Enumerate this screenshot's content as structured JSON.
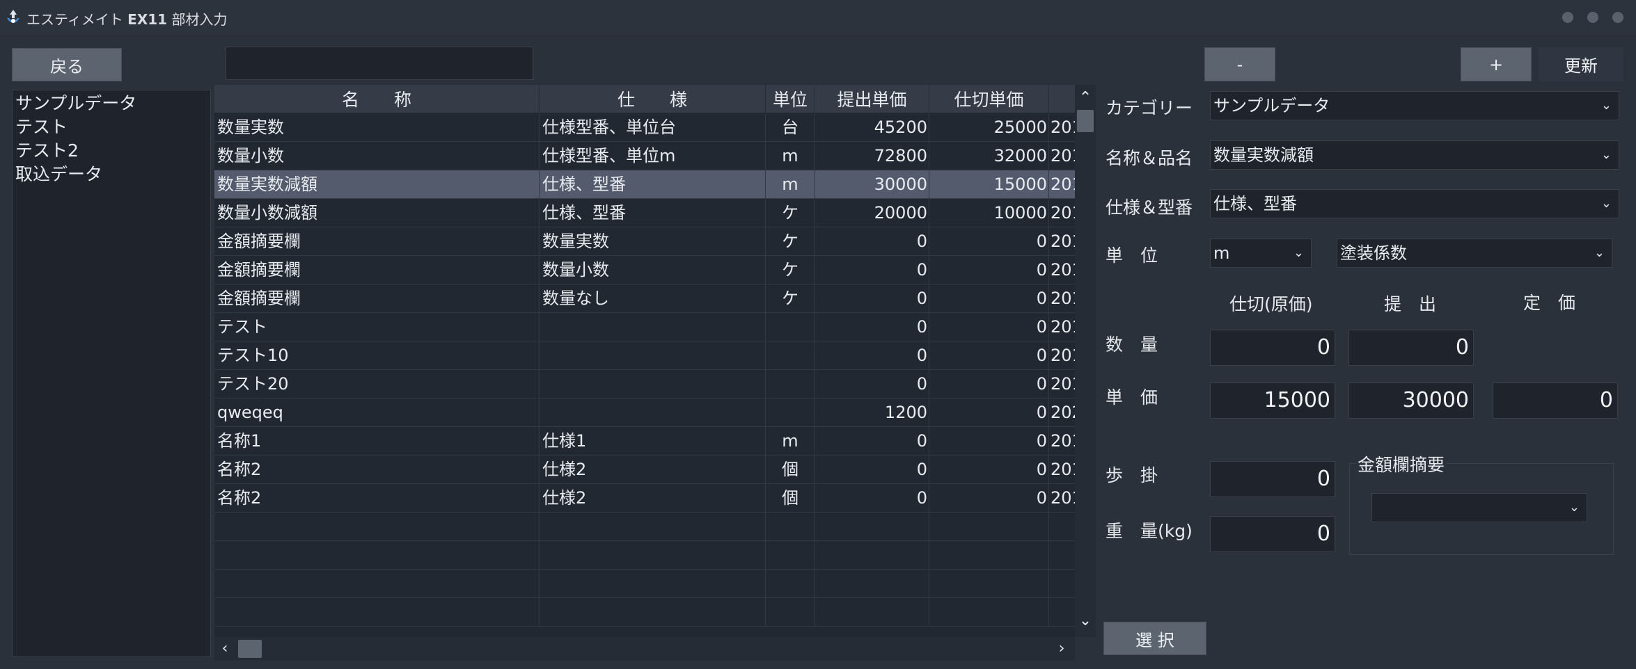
{
  "window": {
    "title_prefix": "エスティメイト",
    "title_bold": "EX11",
    "title_suffix": "部材入力"
  },
  "toolbar": {
    "back_label": "戻る",
    "search_value": "",
    "minus_label": "-",
    "plus_label": "+",
    "update_label": "更新"
  },
  "categories": [
    "サンプルデータ",
    "テスト",
    "テスト2",
    "取込データ"
  ],
  "grid": {
    "headers": [
      "名　　称",
      "仕　　様",
      "単位",
      "提出単価",
      "仕切単価"
    ],
    "rows": [
      {
        "name": "数量実数",
        "spec": "仕様型番、単位台",
        "unit": "台",
        "submit": "45200",
        "cost": "25000",
        "date": "201"
      },
      {
        "name": "数量小数",
        "spec": "仕様型番、単位m",
        "unit": "m",
        "submit": "72800",
        "cost": "32000",
        "date": "201"
      },
      {
        "name": "数量実数減額",
        "spec": "仕様、型番",
        "unit": "m",
        "submit": "30000",
        "cost": "15000",
        "date": "201"
      },
      {
        "name": "数量小数減額",
        "spec": "仕様、型番",
        "unit": "ケ",
        "submit": "20000",
        "cost": "10000",
        "date": "201"
      },
      {
        "name": "金額摘要欄",
        "spec": "数量実数",
        "unit": "ケ",
        "submit": "0",
        "cost": "0",
        "date": "201"
      },
      {
        "name": "金額摘要欄",
        "spec": "数量小数",
        "unit": "ケ",
        "submit": "0",
        "cost": "0",
        "date": "201"
      },
      {
        "name": "金額摘要欄",
        "spec": "数量なし",
        "unit": "ケ",
        "submit": "0",
        "cost": "0",
        "date": "201"
      },
      {
        "name": "テスト",
        "spec": "",
        "unit": "",
        "submit": "0",
        "cost": "0",
        "date": "201"
      },
      {
        "name": "テスト10",
        "spec": "",
        "unit": "",
        "submit": "0",
        "cost": "0",
        "date": "201"
      },
      {
        "name": "テスト20",
        "spec": "",
        "unit": "",
        "submit": "0",
        "cost": "0",
        "date": "201"
      },
      {
        "name": "qweqeq",
        "spec": "",
        "unit": "",
        "submit": "1200",
        "cost": "0",
        "date": "202"
      },
      {
        "name": "名称1",
        "spec": "仕様1",
        "unit": "m",
        "submit": "0",
        "cost": "0",
        "date": "201"
      },
      {
        "name": "名称2",
        "spec": "仕様2",
        "unit": "個",
        "submit": "0",
        "cost": "0",
        "date": "201"
      },
      {
        "name": "名称2",
        "spec": "仕様2",
        "unit": "個",
        "submit": "0",
        "cost": "0",
        "date": "201"
      },
      {
        "name": "",
        "spec": "",
        "unit": "",
        "submit": "",
        "cost": "",
        "date": ""
      },
      {
        "name": "",
        "spec": "",
        "unit": "",
        "submit": "",
        "cost": "",
        "date": ""
      },
      {
        "name": "",
        "spec": "",
        "unit": "",
        "submit": "",
        "cost": "",
        "date": ""
      },
      {
        "name": "",
        "spec": "",
        "unit": "",
        "submit": "",
        "cost": "",
        "date": ""
      }
    ],
    "selected_row": 2
  },
  "form": {
    "category_label": "カテゴリー",
    "category_value": "サンプルデータ",
    "name_label": "名称＆品名",
    "name_value": "数量実数減額",
    "spec_label": "仕様＆型番",
    "spec_value": "仕様、型番",
    "unit_label": "単　位",
    "unit_value": "m",
    "coef_value": "塗装係数",
    "col_cost": "仕切(原価)",
    "col_submit": "提　出",
    "col_list": "定　価",
    "qty_label": "数　量",
    "qty_cost": "0",
    "qty_submit": "0",
    "price_label": "単　価",
    "price_cost": "15000",
    "price_submit": "30000",
    "price_list": "0",
    "rate_label": "歩　掛",
    "rate_value": "0",
    "weight_label": "重　量(kg)",
    "weight_value": "0",
    "summary_group_label": "金額欄摘要",
    "summary_value": "",
    "select_button": "選 択"
  },
  "colors": {
    "background": "#2b313b",
    "selected_row": "#545b6d",
    "button": "#5c6470"
  }
}
